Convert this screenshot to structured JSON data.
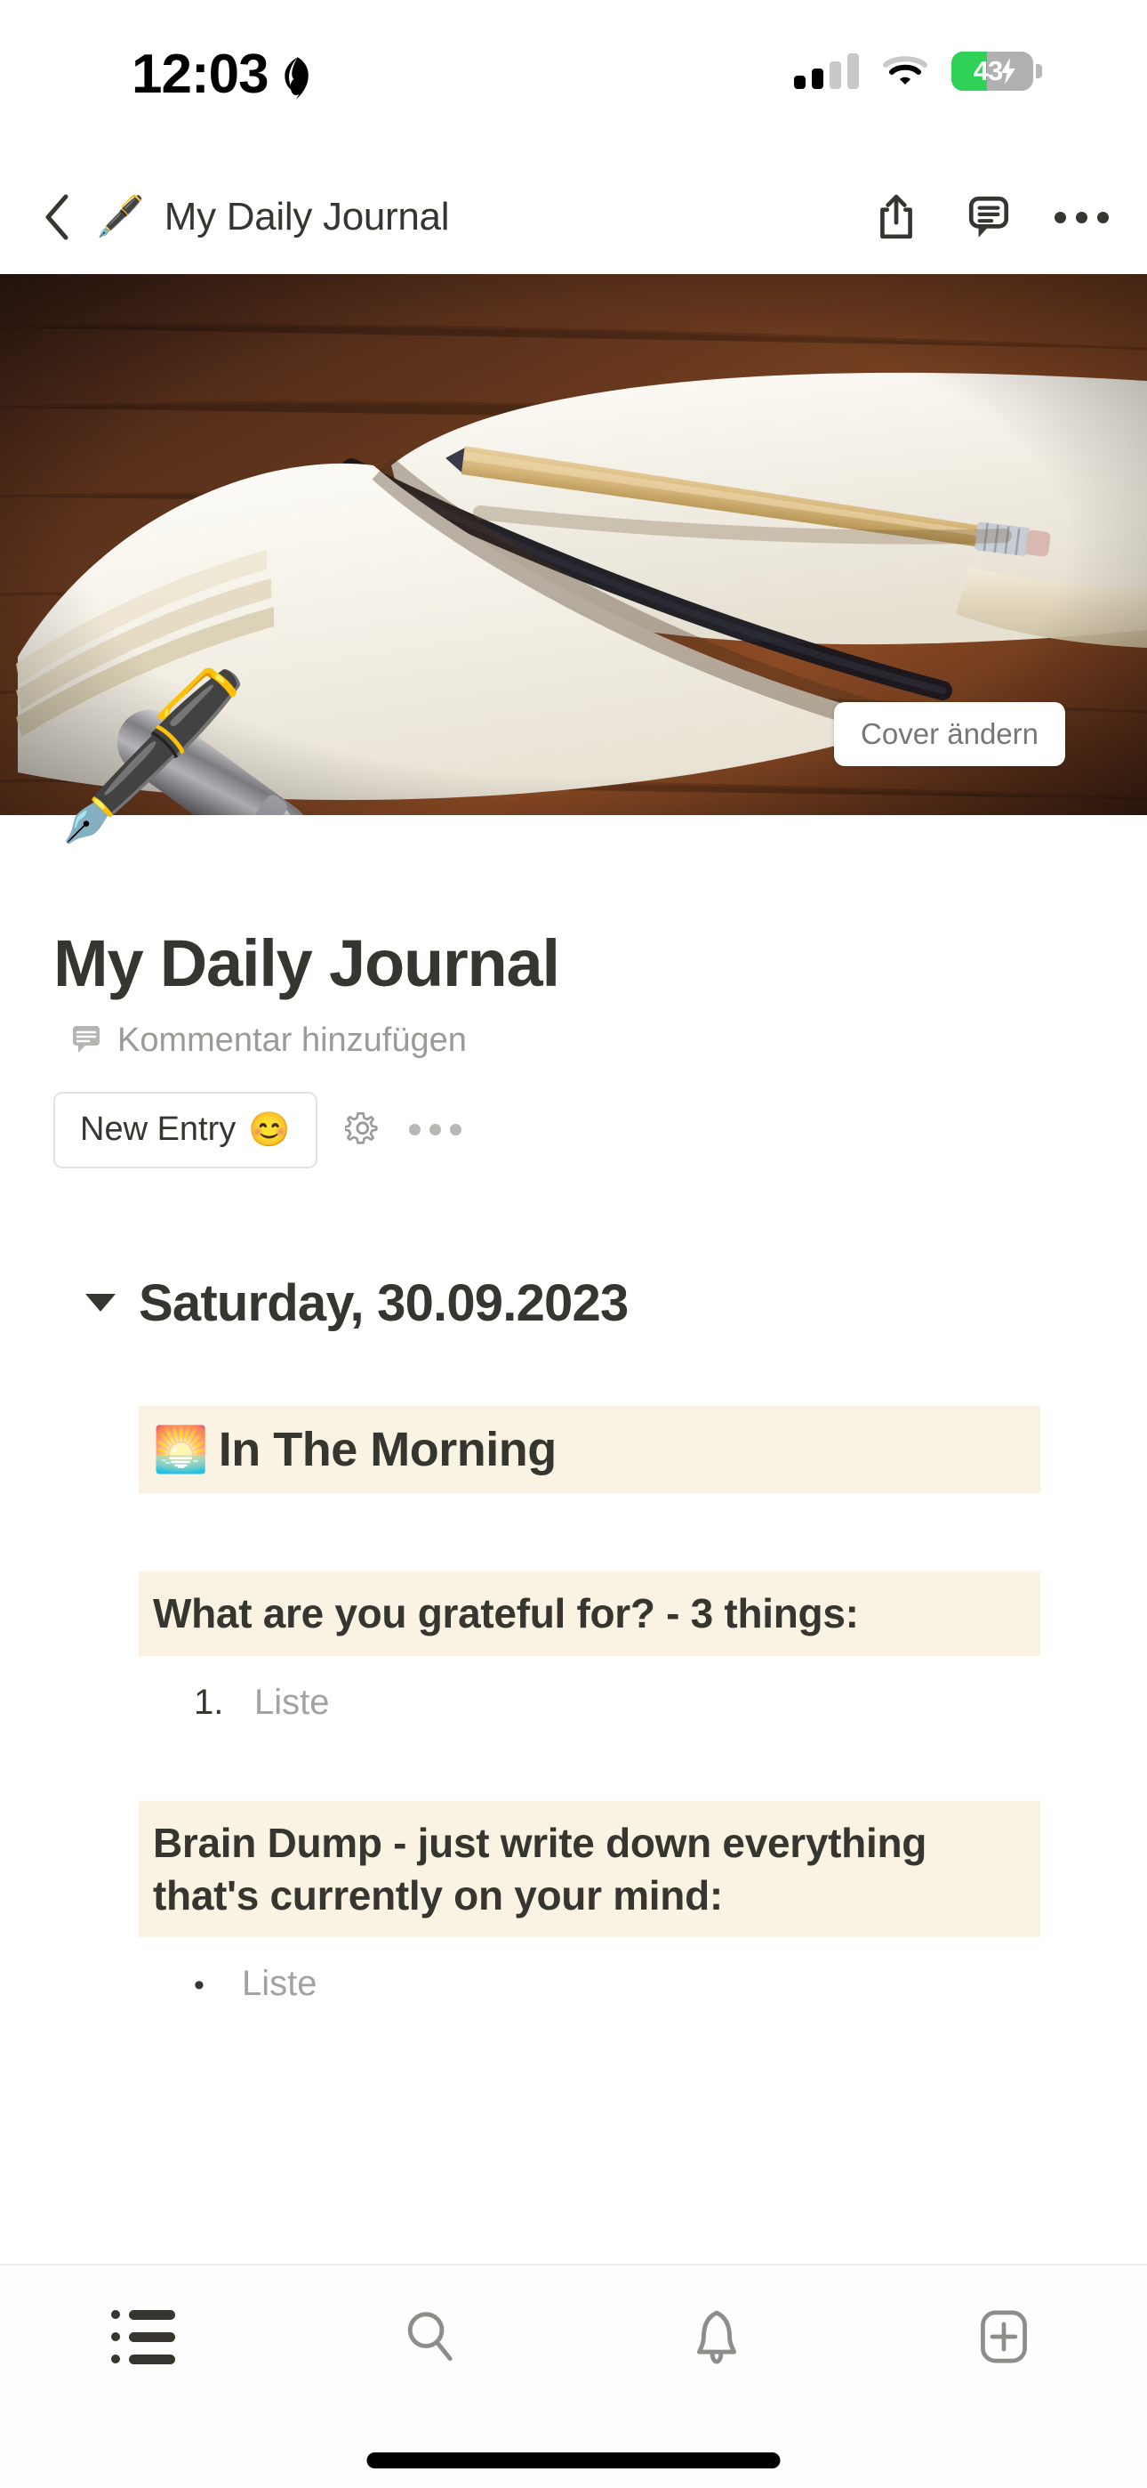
{
  "status_bar": {
    "time": "12:03",
    "focus_icon": "flame-icon",
    "signal_icon": "cellular-signal-icon",
    "signal_bars_filled": 2,
    "signal_bars_total": 4,
    "wifi_icon": "wifi-icon",
    "battery_percent": "43",
    "battery_level": 43,
    "battery_charging": true,
    "battery_color": "#30d158"
  },
  "navbar": {
    "back_icon": "chevron-left-icon",
    "page_emoji": "🖋️",
    "title": "My Daily Journal",
    "share_icon": "share-icon",
    "comment_icon": "comment-icon",
    "more_icon": "more-horizontal-icon"
  },
  "cover": {
    "change_cover_label": "Cover ändern",
    "image_description": "open blank notebook with pencil on wooden desk"
  },
  "page": {
    "icon_emoji": "🖋️",
    "title": "My Daily Journal",
    "add_comment_label": "Kommentar hinzufügen",
    "add_comment_icon": "comment-icon",
    "new_entry_label": "New Entry",
    "new_entry_emoji": "😊",
    "settings_icon": "gear-icon",
    "more_icon": "more-horizontal-icon"
  },
  "content": {
    "date_heading": "Saturday, 30.09.2023",
    "toggle_icon": "triangle-down-icon",
    "callout_bg": "#faf3e3",
    "blocks": [
      {
        "emoji": "🌅",
        "heading": "In The Morning"
      },
      {
        "heading": "What are you grateful for? - 3 things:",
        "list_type": "numbered",
        "list_marker": "1.",
        "list_item": "Liste"
      },
      {
        "heading": "Brain Dump - just write down everything that's currently on your mind:",
        "list_type": "bulleted",
        "list_marker": "•",
        "list_item": "Liste"
      }
    ]
  },
  "tabbar": {
    "items": [
      {
        "name": "list",
        "icon": "list-icon",
        "active": true
      },
      {
        "name": "search",
        "icon": "search-icon",
        "active": false
      },
      {
        "name": "notifications",
        "icon": "bell-icon",
        "active": false
      },
      {
        "name": "create",
        "icon": "plus-square-icon",
        "active": false
      }
    ]
  }
}
